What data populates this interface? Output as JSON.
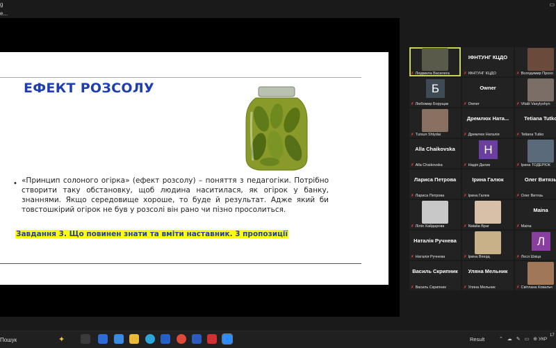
{
  "window": {
    "title_fragment": "g",
    "subtitle_fragment": "e..."
  },
  "slide": {
    "title": "ЕФЕКТ РОЗСОЛУ",
    "bullet_text": "«Принцип солоного огірка» (ефект розсолу) – поняття з педагогіки. Потрібно створити таку обстановку, щоб людина наситилася, як огірок у банку, знаннями. Якщо середовище хороше, то буде й результат. Адже який би товстошкірий огірок не був у розсолі він рано чи пізно просолиться.",
    "task_text": "Завдання 3. Що повинен знати та вміти наставник. 3 пропозиції",
    "image_icon": "pickle-jar-icon"
  },
  "participants": [
    {
      "cap": "Людмила Василега",
      "big": "",
      "tile": "photo",
      "color": "#5a5a4a"
    },
    {
      "cap": "ІФНТУНГ КЦДО",
      "big": "ІФНТУНГ КЦДО",
      "tile": "name"
    },
    {
      "cap": "Володимир Прохо",
      "big": "",
      "tile": "photo",
      "color": "#6a4a3a"
    },
    {
      "cap": "Любомир Борущак",
      "big": "",
      "tile": "letter",
      "letter": "Б",
      "color": "#3e4a55"
    },
    {
      "cap": "Owner",
      "big": "Owner",
      "tile": "name"
    },
    {
      "cap": "Vitalii Vasylyshyn",
      "big": "",
      "tile": "photo",
      "color": "#7a6e66"
    },
    {
      "cap": "Tursun Shlydai",
      "big": "",
      "tile": "photo",
      "color": "#8a7060"
    },
    {
      "cap": "Дремлюх Наталія",
      "big": "Дремлюх Ната...",
      "tile": "name"
    },
    {
      "cap": "Tetiana Tutko",
      "big": "Tetiana Tutko",
      "tile": "name"
    },
    {
      "cap": "Alla Chaikovska",
      "big": "Alla Chaikovska",
      "tile": "name"
    },
    {
      "cap": "Надія Далик",
      "big": "",
      "tile": "letter",
      "letter": "Н",
      "color": "#6b3fa0"
    },
    {
      "cap": "Ірина ТОДЕРЮК",
      "big": "",
      "tile": "photo",
      "color": "#5a6a7a"
    },
    {
      "cap": "Лариса Петрова",
      "big": "Лариса Петрова",
      "tile": "name"
    },
    {
      "cap": "Ірина Галюк",
      "big": "Ірина Галюк",
      "tile": "name"
    },
    {
      "cap": "Олег Витязь",
      "big": "Олег Витязь",
      "tile": "name"
    },
    {
      "cap": "Лілія Хайдарова",
      "big": "",
      "tile": "photo",
      "color": "#c8c8c8"
    },
    {
      "cap": "Natalia Враг",
      "big": "",
      "tile": "photo",
      "color": "#d8c0a8"
    },
    {
      "cap": "Maina",
      "big": "Maina",
      "tile": "name"
    },
    {
      "cap": "Наталія Ручнева",
      "big": "Наталія Ручнева",
      "tile": "name"
    },
    {
      "cap": "Ірина Вперд",
      "big": "",
      "tile": "photo",
      "color": "#c8b088"
    },
    {
      "cap": "Леся Шкіца",
      "big": "",
      "tile": "letter",
      "letter": "Л",
      "color": "#8a3fa0"
    },
    {
      "cap": "Василь Скрипник",
      "big": "Василь Скрипник",
      "tile": "name"
    },
    {
      "cap": "Уляна Мельник",
      "big": "Уляна Мельник",
      "tile": "name"
    },
    {
      "cap": "Світлана Ковальч",
      "big": "",
      "tile": "photo",
      "color": "#a07858"
    }
  ],
  "taskbar": {
    "search_label": "Пошук",
    "result_label": "Result",
    "lang_label": "УКР",
    "clock_fragment": "17"
  }
}
